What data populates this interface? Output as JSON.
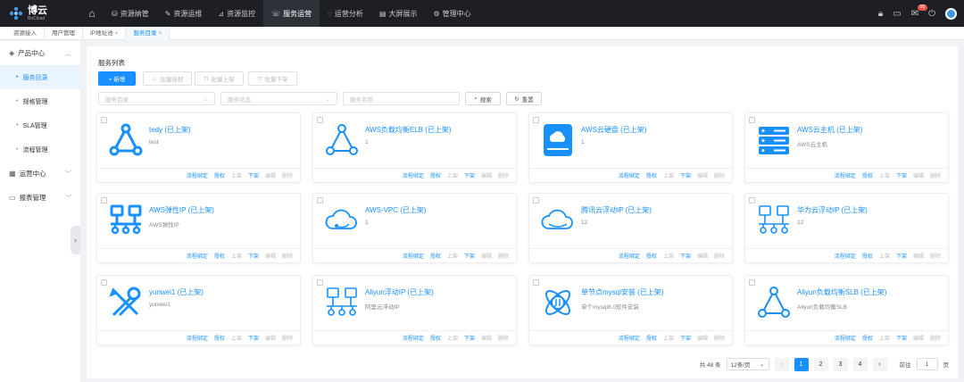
{
  "app": {
    "name": "博云",
    "subname": "BoCloud"
  },
  "topnav": {
    "items": [
      {
        "label": "资源纳管",
        "icon": "database-icon"
      },
      {
        "label": "资源运维",
        "icon": "wrench-icon"
      },
      {
        "label": "资源监控",
        "icon": "chart-icon"
      },
      {
        "label": "服务运营",
        "icon": "service-icon"
      },
      {
        "label": "运营分析",
        "icon": "analysis-icon"
      },
      {
        "label": "大屏展示",
        "icon": "screen-icon"
      },
      {
        "label": "管理中心",
        "icon": "gear-icon"
      }
    ],
    "badge": "90"
  },
  "tabs": [
    {
      "label": "资源接入",
      "close": ""
    },
    {
      "label": "用户管理",
      "close": ""
    },
    {
      "label": "IP地址池",
      "close": "×"
    },
    {
      "label": "服务目录",
      "close": "×"
    }
  ],
  "sidebar": {
    "groups": [
      {
        "label": "产品中心",
        "items": [
          "服务目录",
          "规格管理",
          "SLA管理",
          "流程管理"
        ]
      },
      {
        "label": "运营中心"
      },
      {
        "label": "报表管理"
      }
    ]
  },
  "main": {
    "title": "服务列表",
    "buttons": {
      "add": "+ 新增",
      "grant": "批量授权",
      "up": "批量上架",
      "down": "批量下架"
    },
    "filters": {
      "catalog": "服务目录",
      "status": "服务状态",
      "name": "服务名称"
    },
    "search": "搜索",
    "reset": "重置"
  },
  "cards": [
    {
      "title": "tedy (已上架)",
      "desc": "test",
      "icon": "triangle-network-icon"
    },
    {
      "title": "AWS负载均衡ELB (已上架)",
      "desc": "1",
      "icon": "load-balancer-icon"
    },
    {
      "title": "AWS云硬盘 (已上架)",
      "desc": "1",
      "icon": "cloud-disk-icon"
    },
    {
      "title": "AWS云主机 (已上架)",
      "desc": "AWS云主机",
      "icon": "server-icon"
    },
    {
      "title": "AWS弹性IP (已上架)",
      "desc": "AWS弹性IP",
      "icon": "network-nodes-icon"
    },
    {
      "title": "AWS-VPC (已上架)",
      "desc": "1",
      "icon": "cloud-vpc-icon"
    },
    {
      "title": "腾讯云浮动IP (已上架)",
      "desc": "12",
      "icon": "cloud-icon"
    },
    {
      "title": "华为云浮动IP (已上架)",
      "desc": "12",
      "icon": "network-nodes-outline-icon"
    },
    {
      "title": "yunwei1 (已上架)",
      "desc": "yunwei1",
      "icon": "tools-icon"
    },
    {
      "title": "Aliyun浮动IP (已上架)",
      "desc": "阿里云浮动IP",
      "icon": "network-nodes-outline-icon"
    },
    {
      "title": "单节点mysql安装 (已上架)",
      "desc": "单个mysql8.0软件安装",
      "icon": "atom-icon"
    },
    {
      "title": "Aliyun负载均衡SLB (已上架)",
      "desc": "Aliyun负载均衡SLB",
      "icon": "load-balancer-icon"
    }
  ],
  "card_actions": {
    "flow": "流程绑定",
    "grant": "授权",
    "up": "上架",
    "down": "下架",
    "edit": "编辑",
    "delete": "删除"
  },
  "pagination": {
    "total": "共 48 条",
    "size": "12条/页",
    "pages": [
      "1",
      "2",
      "3",
      "4"
    ],
    "current": "1",
    "goto": "前往",
    "goto_value": "1",
    "page_unit": "页"
  },
  "colors": {
    "accent": "#1890ff",
    "topbar": "#1e1f24"
  }
}
